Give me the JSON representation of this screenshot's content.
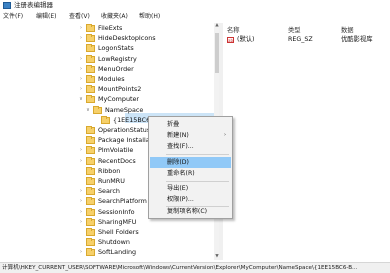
{
  "window": {
    "title": "注册表编辑器"
  },
  "menubar": [
    "文件(F)",
    "编辑(E)",
    "查看(V)",
    "收藏夹(A)",
    "帮助(H)"
  ],
  "tree": [
    {
      "label": "FileExts",
      "chevron": "›",
      "level": 1
    },
    {
      "label": "HideDesktopIcons",
      "chevron": "›",
      "level": 1
    },
    {
      "label": "LogonStats",
      "chevron": "",
      "level": 1
    },
    {
      "label": "LowRegistry",
      "chevron": "›",
      "level": 1
    },
    {
      "label": "MenuOrder",
      "chevron": "›",
      "level": 1
    },
    {
      "label": "Modules",
      "chevron": "›",
      "level": 1
    },
    {
      "label": "MountPoints2",
      "chevron": "›",
      "level": 1
    },
    {
      "label": "MyComputer",
      "chevron": "∨",
      "level": 1
    },
    {
      "label": "NameSpace",
      "chevron": "∨",
      "level": 2
    },
    {
      "label": "{1EE15BC6-",
      "chevron": "",
      "level": 3,
      "selected": true
    },
    {
      "label": "OperationStatusI",
      "chevron": "",
      "level": 1
    },
    {
      "label": "Package Installat",
      "chevron": "",
      "level": 1
    },
    {
      "label": "PlmVolatile",
      "chevron": "›",
      "level": 1
    },
    {
      "label": "RecentDocs",
      "chevron": "›",
      "level": 1
    },
    {
      "label": "Ribbon",
      "chevron": "",
      "level": 1
    },
    {
      "label": "RunMRU",
      "chevron": "",
      "level": 1
    },
    {
      "label": "Search",
      "chevron": "›",
      "level": 1
    },
    {
      "label": "SearchPlatform",
      "chevron": "›",
      "level": 1
    },
    {
      "label": "SessionInfo",
      "chevron": "›",
      "level": 1
    },
    {
      "label": "SharingMFU",
      "chevron": "›",
      "level": 1
    },
    {
      "label": "Shell Folders",
      "chevron": "",
      "level": 1
    },
    {
      "label": "Shutdown",
      "chevron": "",
      "level": 1
    },
    {
      "label": "SoftLanding",
      "chevron": "›",
      "level": 1
    }
  ],
  "columns": {
    "name": "名称",
    "type": "类型",
    "data": "数据"
  },
  "values": [
    {
      "icon_text": "ab",
      "name": "(默认)",
      "type": "REG_SZ",
      "data": "优酷影视库"
    }
  ],
  "context_menu": [
    {
      "label": "折叠",
      "sub": ""
    },
    {
      "label": "新建(N)",
      "sub": "›"
    },
    {
      "label": "查找(F)...",
      "sub": ""
    },
    {
      "label": "删除(D)",
      "sub": "",
      "highlight": true
    },
    {
      "label": "重命名(R)",
      "sub": ""
    },
    {
      "label": "导出(E)",
      "sub": ""
    },
    {
      "label": "权限(P)...",
      "sub": ""
    },
    {
      "label": "复制项名称(C)",
      "sub": ""
    }
  ],
  "status": "计算机\\HKEY_CURRENT_USER\\SOFTWARE\\Microsoft\\Windows\\CurrentVersion\\Explorer\\MyComputer\\NameSpace\\{1EE15BC6-B..."
}
